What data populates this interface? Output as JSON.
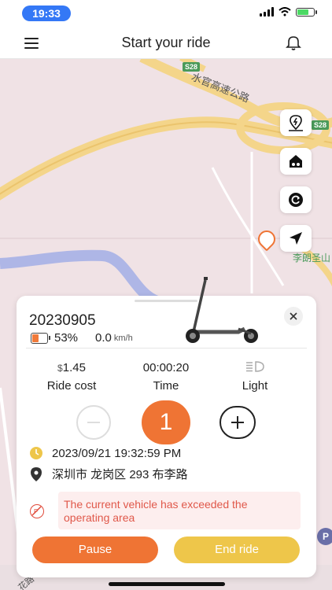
{
  "status_bar": {
    "time": "19:33"
  },
  "header": {
    "title": "Start your ride",
    "menu_icon": "menu-icon",
    "notification_icon": "bell-icon"
  },
  "map": {
    "labels": {
      "expressway": "水官高速公路",
      "road_code_1": "S28",
      "road_code_2": "S28",
      "place": "李朗圣山",
      "street": "花路"
    },
    "side_buttons": [
      "parking-icon",
      "home-icon",
      "refresh-icon",
      "locate-icon"
    ]
  },
  "ride": {
    "vehicle_id": "20230905",
    "battery": "53%",
    "speed": "0.0",
    "speed_unit": "km/h",
    "stats": [
      {
        "currency": "$",
        "value": "1.45",
        "label": "Ride cost"
      },
      {
        "value": "00:00:20",
        "label": "Time"
      },
      {
        "value": "",
        "label": "Light"
      }
    ],
    "count": "1",
    "datetime": "2023/09/21 19:32:59 PM",
    "address": "深圳市 龙岗区 293 布李路",
    "warning": "The current vehicle has exceeded the operating area",
    "pause_label": "Pause",
    "end_label": "End ride"
  },
  "colors": {
    "primary": "#ef7434",
    "secondary": "#eec64a",
    "warning": "#e0584a"
  }
}
